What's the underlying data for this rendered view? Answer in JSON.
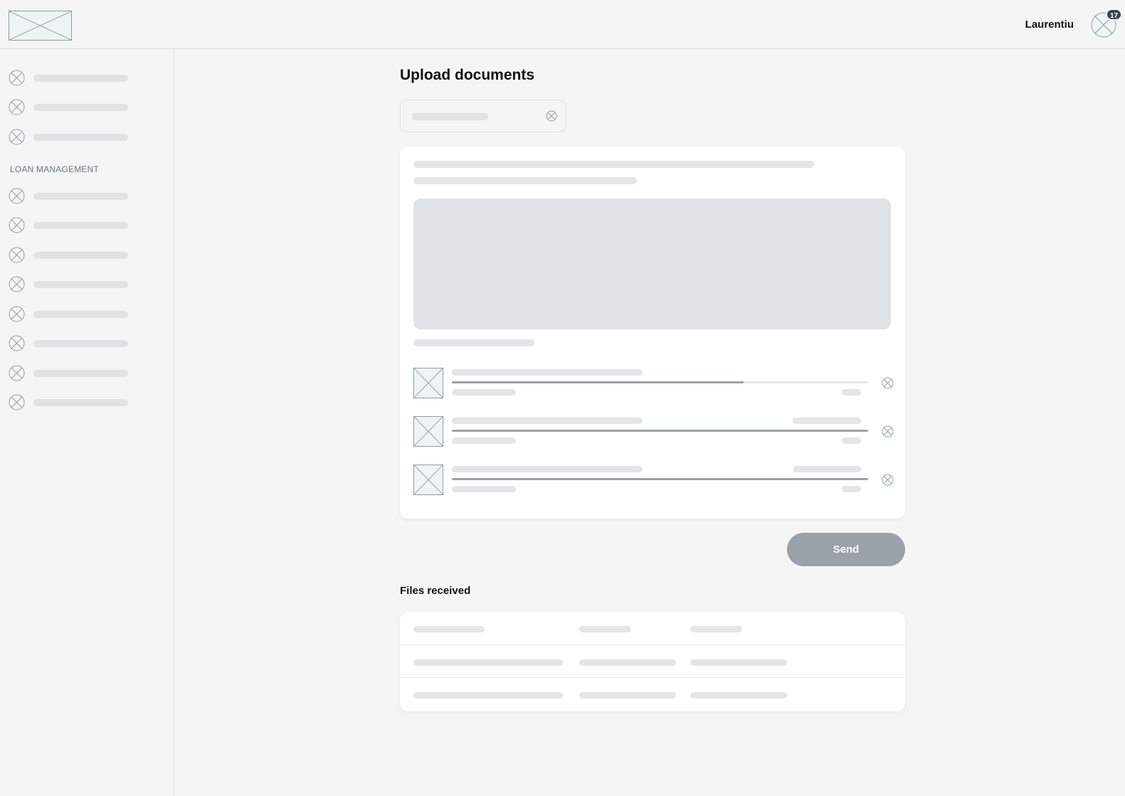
{
  "header": {
    "logo_icon": "image-placeholder-icon",
    "user_name": "Laurentiu",
    "avatar_icon": "avatar-placeholder-icon",
    "notification_count": "17"
  },
  "sidebar": {
    "top_items": [
      {
        "icon": "placeholder-icon"
      },
      {
        "icon": "placeholder-icon"
      },
      {
        "icon": "placeholder-icon"
      }
    ],
    "section_label": "LOAN MANAGEMENT",
    "section_items": [
      {
        "icon": "placeholder-icon"
      },
      {
        "icon": "placeholder-icon"
      },
      {
        "icon": "placeholder-icon"
      },
      {
        "icon": "placeholder-icon"
      },
      {
        "icon": "placeholder-icon"
      },
      {
        "icon": "placeholder-icon"
      },
      {
        "icon": "placeholder-icon"
      },
      {
        "icon": "placeholder-icon"
      }
    ]
  },
  "main": {
    "title": "Upload documents",
    "document_type_select": {
      "clear_icon": "clear-icon"
    },
    "upload_files": [
      {
        "progress": 0.7,
        "has_meta": false
      },
      {
        "progress": 1.0,
        "has_meta": true
      },
      {
        "progress": 1.0,
        "has_meta": true
      }
    ],
    "send_label": "Send",
    "files_received_title": "Files received",
    "files_table_rows": 3
  },
  "colors": {
    "background": "#f5f5f5",
    "card": "#ffffff",
    "skeleton": "#e3e5e7",
    "progress_fill": "#9aa1a8",
    "button": "#9aa1a9",
    "badge": "#3b4450"
  }
}
